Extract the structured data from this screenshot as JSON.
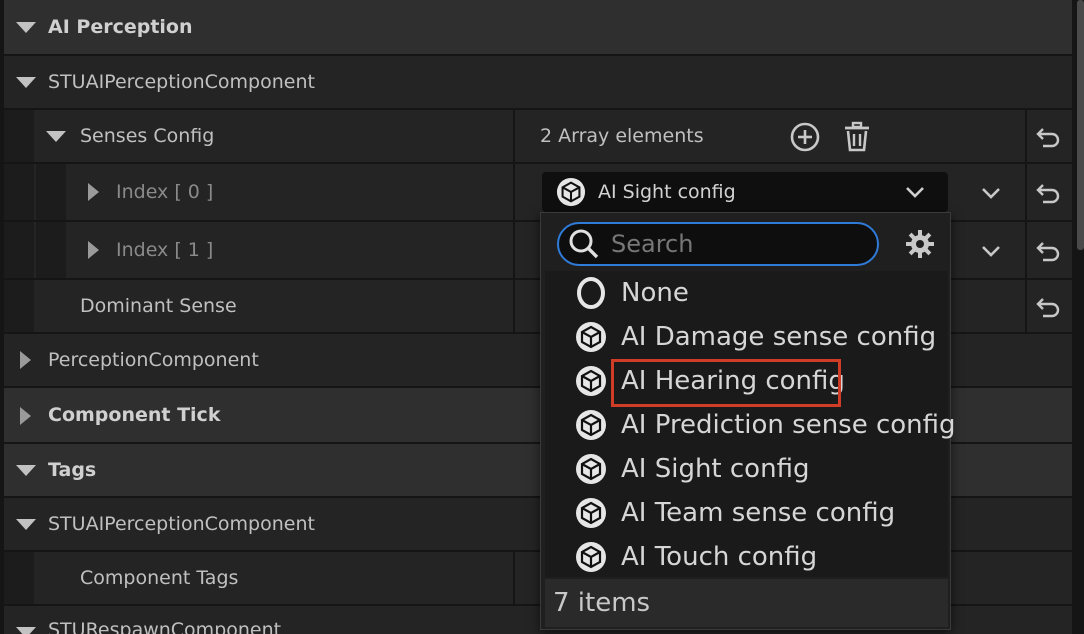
{
  "details": {
    "ai_perception_category": "AI Perception",
    "perception_component_1": "STUAIPerceptionComponent",
    "senses_config": {
      "label": "Senses Config",
      "value": "2 Array elements"
    },
    "index_0": "Index [ 0 ]",
    "index_1": "Index [ 1 ]",
    "dominant_sense": "Dominant Sense",
    "perception_component": "PerceptionComponent",
    "component_tick_category": "Component Tick",
    "tags_category": "Tags",
    "perception_component_2": "STUAIPerceptionComponent",
    "component_tags": "Component Tags",
    "respawn_component": "STURespawnComponent"
  },
  "combo": {
    "selected": "AI Sight config",
    "icon": "actor-class-icon"
  },
  "dropdown": {
    "search_placeholder": "Search",
    "items": [
      {
        "label": "None",
        "icon": "none-ring-icon"
      },
      {
        "label": "AI Damage sense config",
        "icon": "class-icon"
      },
      {
        "label": "AI Hearing config",
        "icon": "class-icon",
        "highlighted": true
      },
      {
        "label": "AI Prediction sense config",
        "icon": "class-icon"
      },
      {
        "label": "AI Sight config",
        "icon": "class-icon"
      },
      {
        "label": "AI Team sense config",
        "icon": "class-icon"
      },
      {
        "label": "AI Touch config",
        "icon": "class-icon"
      }
    ],
    "footer": "7 items"
  },
  "colors": {
    "highlight_border": "#d03c25",
    "search_focus": "#2f7bd8"
  }
}
